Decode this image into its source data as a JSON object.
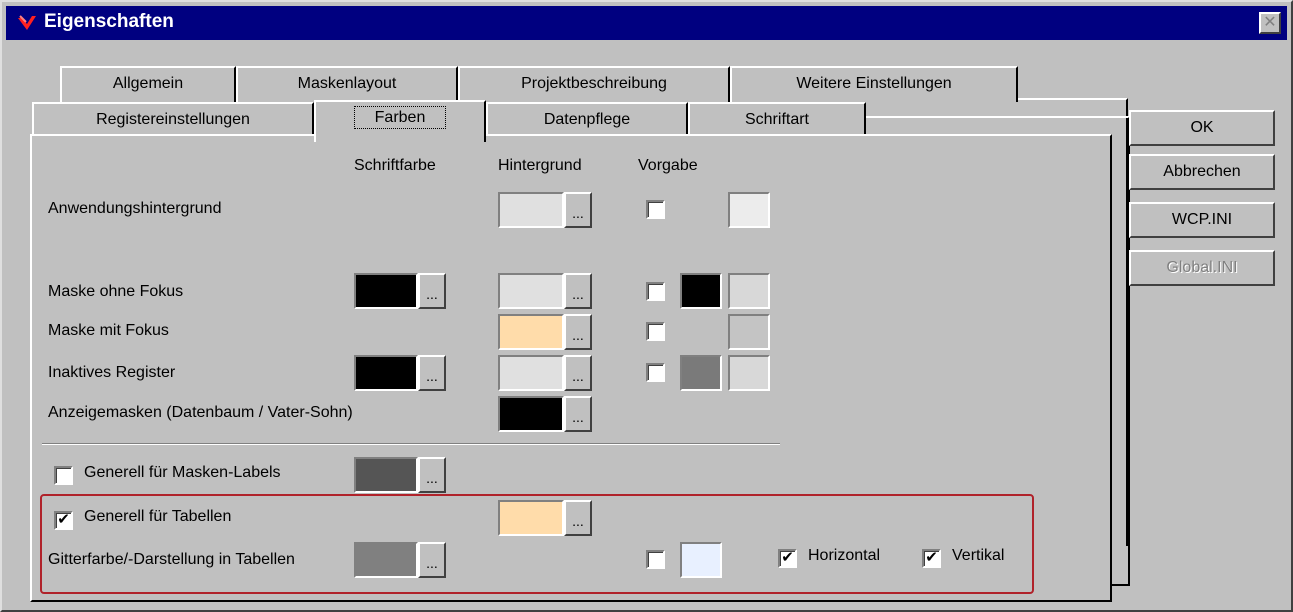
{
  "window": {
    "title": "Eigenschaften",
    "close": "✕"
  },
  "tabs_back": [
    "Allgemein",
    "Maskenlayout",
    "Projektbeschreibung",
    "Weitere Einstellungen"
  ],
  "tabs_front": [
    "Registereinstellungen",
    "Farben",
    "Datenpflege",
    "Schriftart"
  ],
  "active_tab": "Farben",
  "headers": {
    "font_color": "Schriftfarbe",
    "background": "Hintergrund",
    "default": "Vorgabe"
  },
  "rows": {
    "app_bg": "Anwendungshintergrund",
    "mask_no_focus": "Maske ohne Fokus",
    "mask_focus": "Maske mit Fokus",
    "inactive_register": "Inaktives Register",
    "display_masks": "Anzeigemasken (Datenbaum / Vater-Sohn)",
    "general_mask_labels": "Generell für Masken-Labels",
    "general_tables": "Generell für Tabellen",
    "grid_color": "Gitterfarbe/-Darstellung in Tabellen"
  },
  "checks": {
    "general_mask_labels": false,
    "general_tables": true,
    "horizontal": true,
    "vertical": true
  },
  "grid_options": {
    "horizontal": "Horizontal",
    "vertical": "Vertikal"
  },
  "dots": "...",
  "buttons": {
    "ok": "OK",
    "cancel": "Abbrechen",
    "wcp": "WCP.INI",
    "global": "Global.INI"
  },
  "colors": {
    "black": "#000000",
    "light_gray": "#e0e0e0",
    "peach": "#ffdcaa",
    "dark_gray": "#555555",
    "mid_gray": "#808080",
    "pale_blue": "#e8f0ff",
    "preview_light": "#ececec"
  }
}
